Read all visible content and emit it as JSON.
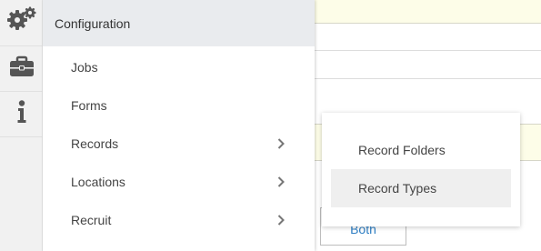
{
  "background": {
    "both_button_label": "Both"
  },
  "rail": {
    "items": [
      {
        "icon": "gears-icon"
      },
      {
        "icon": "briefcase-icon"
      },
      {
        "icon": "info-icon"
      }
    ]
  },
  "menu": {
    "title": "Configuration",
    "items": [
      {
        "label": "Jobs",
        "has_submenu": false
      },
      {
        "label": "Forms",
        "has_submenu": false
      },
      {
        "label": "Records",
        "has_submenu": true
      },
      {
        "label": "Locations",
        "has_submenu": true
      },
      {
        "label": "Recruit",
        "has_submenu": true
      }
    ]
  },
  "submenu": {
    "items": [
      {
        "label": "Record Folders",
        "active": false
      },
      {
        "label": "Record Types",
        "active": true
      }
    ]
  },
  "colors": {
    "header_bg": "#e9ebee",
    "highlight_bg": "#efefef",
    "accent": "#2f7fc4",
    "icon": "#555555"
  }
}
